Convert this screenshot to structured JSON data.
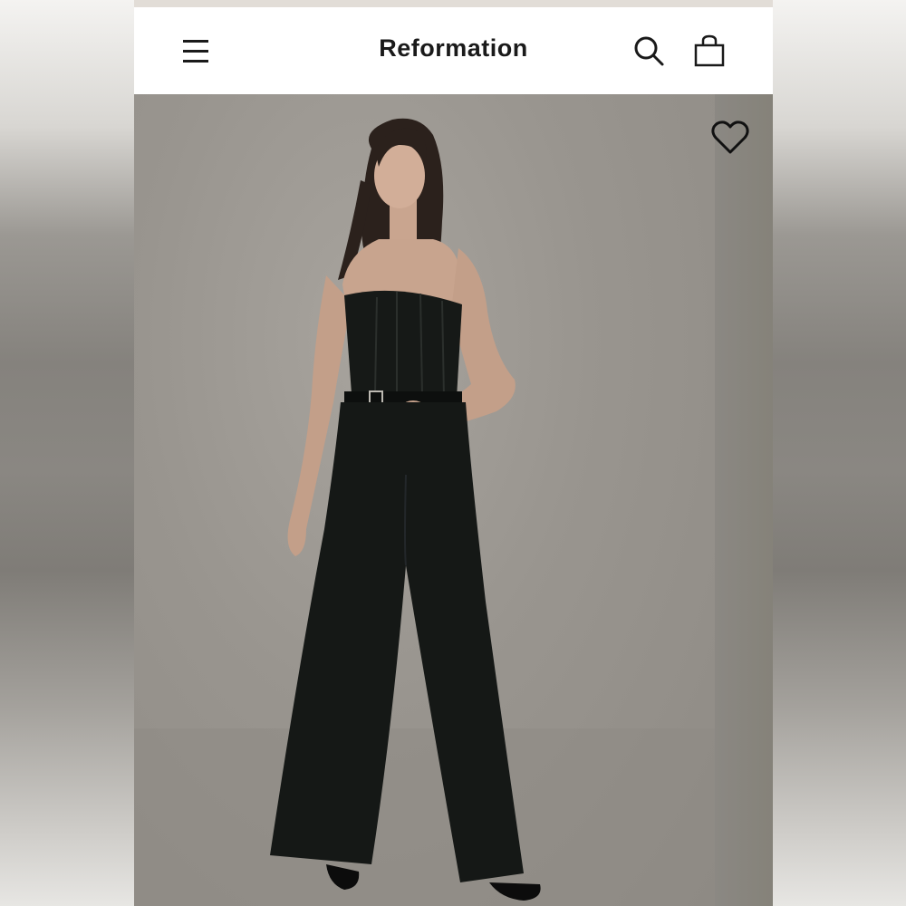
{
  "header": {
    "brand": "Reformation",
    "menu_icon": "hamburger-menu-icon",
    "search_icon": "search-icon",
    "bag_icon": "shopping-bag-icon"
  },
  "product": {
    "image_alt": "",
    "wishlist_icon": "heart-icon"
  },
  "colors": {
    "header_bg": "#ffffff",
    "brand_text": "#1a1a1a",
    "hero_bg": "#99958f",
    "garment": "#151816"
  }
}
